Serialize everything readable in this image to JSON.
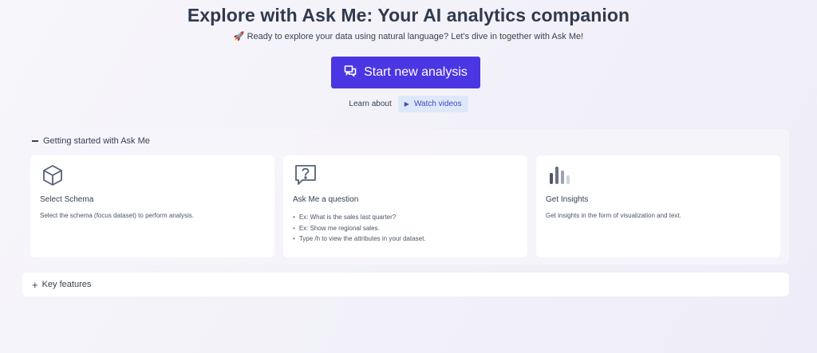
{
  "header": {
    "title": "Explore with Ask Me: Your AI analytics companion",
    "subtitle": "🚀 Ready to explore your data using natural language? Let's dive in together with Ask Me!"
  },
  "actions": {
    "start_label": "Start new analysis",
    "learn_label": "Learn about",
    "watch_label": "Watch videos"
  },
  "getting_started": {
    "header": "Getting started with Ask Me",
    "cards": [
      {
        "icon": "cube-icon",
        "title": "Select Schema",
        "description": "Select the schema (focus dataset) to perform analysis."
      },
      {
        "icon": "question-bubble-icon",
        "title": "Ask Me a question",
        "bullets": [
          "Ex: What is the sales last quarter?",
          "Ex: Show me regional sales.",
          "Type /h to view the attributes in your dataset."
        ]
      },
      {
        "icon": "bar-chart-icon",
        "title": "Get Insights",
        "description": "Get insights in the form of visualization and text."
      }
    ]
  },
  "key_features": {
    "header": "Key features"
  },
  "colors": {
    "primary": "#4b36e3",
    "watch_bg": "#dfe8fb",
    "watch_text": "#3f4ab8"
  }
}
